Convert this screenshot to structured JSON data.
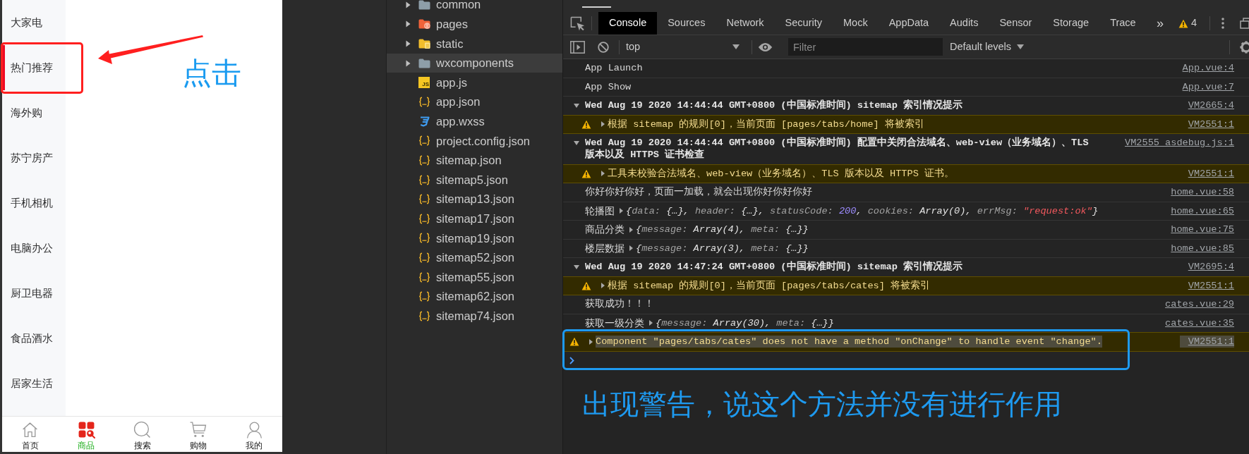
{
  "phone": {
    "categories": [
      {
        "label": "大家电",
        "selected": false
      },
      {
        "label": "热门推荐",
        "selected": true
      },
      {
        "label": "海外购",
        "selected": false
      },
      {
        "label": "苏宁房产",
        "selected": false
      },
      {
        "label": "手机相机",
        "selected": false
      },
      {
        "label": "电脑办公",
        "selected": false
      },
      {
        "label": "厨卫电器",
        "selected": false
      },
      {
        "label": "食品酒水",
        "selected": false
      },
      {
        "label": "居家生活",
        "selected": false
      }
    ],
    "tab_bar": [
      {
        "label": "首页",
        "kind": "home",
        "selected": false
      },
      {
        "label": "商品",
        "kind": "goods",
        "selected": true
      },
      {
        "label": "搜索",
        "kind": "search",
        "selected": false
      },
      {
        "label": "购物",
        "kind": "cart",
        "selected": false
      },
      {
        "label": "我的",
        "kind": "user",
        "selected": false
      }
    ]
  },
  "annotations": {
    "click_label": "点击",
    "warning_note": "出现警告，说这个方法并没有进行作用"
  },
  "file_tree": {
    "folders": [
      {
        "name": "common",
        "kind": "plain",
        "expanded": false,
        "selected": false
      },
      {
        "name": "pages",
        "kind": "pages",
        "expanded": false,
        "selected": false
      },
      {
        "name": "static",
        "kind": "assets",
        "expanded": false,
        "selected": false
      },
      {
        "name": "wxcomponents",
        "kind": "plain",
        "expanded": false,
        "selected": true
      }
    ],
    "files": [
      {
        "name": "app.js",
        "kind": "script",
        "badge": "JS",
        "selected": false
      },
      {
        "name": "app.json",
        "kind": "json",
        "selected": false
      },
      {
        "name": "app.wxss",
        "kind": "style",
        "selected": false
      },
      {
        "name": "project.config.json",
        "kind": "json",
        "selected": false
      },
      {
        "name": "sitemap.json",
        "kind": "json",
        "selected": false
      },
      {
        "name": "sitemap5.json",
        "kind": "json",
        "selected": false
      },
      {
        "name": "sitemap13.json",
        "kind": "json",
        "selected": false
      },
      {
        "name": "sitemap17.json",
        "kind": "json",
        "selected": false
      },
      {
        "name": "sitemap19.json",
        "kind": "json",
        "selected": false
      },
      {
        "name": "sitemap52.json",
        "kind": "json",
        "selected": false
      },
      {
        "name": "sitemap55.json",
        "kind": "json",
        "selected": false
      },
      {
        "name": "sitemap62.json",
        "kind": "json",
        "selected": false
      },
      {
        "name": "sitemap74.json",
        "kind": "json",
        "selected": false
      }
    ]
  },
  "devtools": {
    "tabs": [
      {
        "label": "Console",
        "selected": true
      },
      {
        "label": "Sources",
        "selected": false
      },
      {
        "label": "Network",
        "selected": false
      },
      {
        "label": "Security",
        "selected": false
      },
      {
        "label": "Mock",
        "selected": false
      },
      {
        "label": "AppData",
        "selected": false
      },
      {
        "label": "Audits",
        "selected": false
      },
      {
        "label": "Sensor",
        "selected": false
      },
      {
        "label": "Storage",
        "selected": false
      },
      {
        "label": "Trace",
        "selected": false
      }
    ],
    "overflow": "»",
    "warning_count": "4",
    "context": "top",
    "filter": {
      "placeholder": "Filter"
    },
    "levels": "Default levels"
  },
  "console": [
    {
      "kind": "log",
      "text": "App Launch",
      "source": "App.vue:4",
      "highlighted": false
    },
    {
      "kind": "log",
      "text": "App Show",
      "source": "App.vue:7",
      "highlighted": false
    },
    {
      "kind": "group",
      "text": "Wed Aug 19 2020 14:44:44 GMT+0800 (中国标准时间) sitemap 索引情况提示",
      "source": "VM2665:4",
      "expanded": true,
      "highlighted": false,
      "children": [
        {
          "kind": "warning",
          "text": "根据 sitemap 的规则[0]，当前页面 [pages/tabs/home] 将被索引",
          "source": "VM2551:1",
          "expanded": false,
          "highlighted": false
        }
      ]
    },
    {
      "kind": "group",
      "text": "Wed Aug 19 2020 14:44:44 GMT+0800 (中国标准时间) 配置中关闭合法域名、web-view（业务域名）、TLS 版本以及 HTTPS 证书检查",
      "source": "VM2555 asdebug.js:1",
      "expanded": true,
      "highlighted": false,
      "children": [
        {
          "kind": "warning",
          "text": "工具未校验合法域名、web-view（业务域名）、TLS 版本以及 HTTPS 证书。",
          "source": "VM2551:1",
          "expanded": false,
          "highlighted": false
        }
      ]
    },
    {
      "kind": "log",
      "text": "你好你好你好，页面一加载，就会出现你好你好你好",
      "source": "home.vue:58",
      "highlighted": false
    },
    {
      "kind": "object",
      "label": "轮播图",
      "preview": [
        {
          "text": "{",
          "kind": "value"
        },
        {
          "text": "data: ",
          "kind": "key"
        },
        {
          "text": "{…}, ",
          "kind": "value"
        },
        {
          "text": "header: ",
          "kind": "key"
        },
        {
          "text": "{…}, ",
          "kind": "value"
        },
        {
          "text": "statusCode: ",
          "kind": "key"
        },
        {
          "text": "200",
          "kind": "number"
        },
        {
          "text": ", ",
          "kind": "value"
        },
        {
          "text": "cookies: ",
          "kind": "key"
        },
        {
          "text": "Array(0), ",
          "kind": "value"
        },
        {
          "text": "errMsg: ",
          "kind": "key"
        },
        {
          "text": "\"request:ok\"",
          "kind": "string"
        },
        {
          "text": "}",
          "kind": "value"
        }
      ],
      "source": "home.vue:65",
      "expanded": false,
      "highlighted": false
    },
    {
      "kind": "object",
      "label": "商品分类",
      "preview": [
        {
          "text": "{",
          "kind": "value"
        },
        {
          "text": "message: ",
          "kind": "key"
        },
        {
          "text": "Array(4), ",
          "kind": "value"
        },
        {
          "text": "meta: ",
          "kind": "key"
        },
        {
          "text": "{…}}",
          "kind": "value"
        }
      ],
      "source": "home.vue:75",
      "expanded": false,
      "highlighted": false
    },
    {
      "kind": "object",
      "label": "楼层数据",
      "preview": [
        {
          "text": "{",
          "kind": "value"
        },
        {
          "text": "message: ",
          "kind": "key"
        },
        {
          "text": "Array(3), ",
          "kind": "value"
        },
        {
          "text": "meta: ",
          "kind": "key"
        },
        {
          "text": "{…}}",
          "kind": "value"
        }
      ],
      "source": "home.vue:85",
      "expanded": false,
      "highlighted": false
    },
    {
      "kind": "group",
      "text": "Wed Aug 19 2020 14:47:24 GMT+0800 (中国标准时间) sitemap 索引情况提示",
      "source": "VM2695:4",
      "expanded": true,
      "highlighted": false,
      "children": [
        {
          "kind": "warning",
          "text": "根据 sitemap 的规则[0]，当前页面 [pages/tabs/cates] 将被索引",
          "source": "VM2551:1",
          "expanded": false,
          "highlighted": false
        }
      ]
    },
    {
      "kind": "log",
      "text": "获取成功！！！",
      "source": "cates.vue:29",
      "highlighted": false
    },
    {
      "kind": "object",
      "label": "获取一级分类",
      "preview": [
        {
          "text": "{",
          "kind": "value"
        },
        {
          "text": "message: ",
          "kind": "key"
        },
        {
          "text": "Array(30), ",
          "kind": "value"
        },
        {
          "text": "meta: ",
          "kind": "key"
        },
        {
          "text": "{…}}",
          "kind": "value"
        }
      ],
      "source": "cates.vue:35",
      "expanded": false,
      "highlighted": false
    },
    {
      "kind": "warning",
      "text": "Component \"pages/tabs/cates\" does not have a method \"onChange\" to handle event \"change\".",
      "source": "VM2551:1",
      "expanded": false,
      "highlighted": true
    }
  ]
}
